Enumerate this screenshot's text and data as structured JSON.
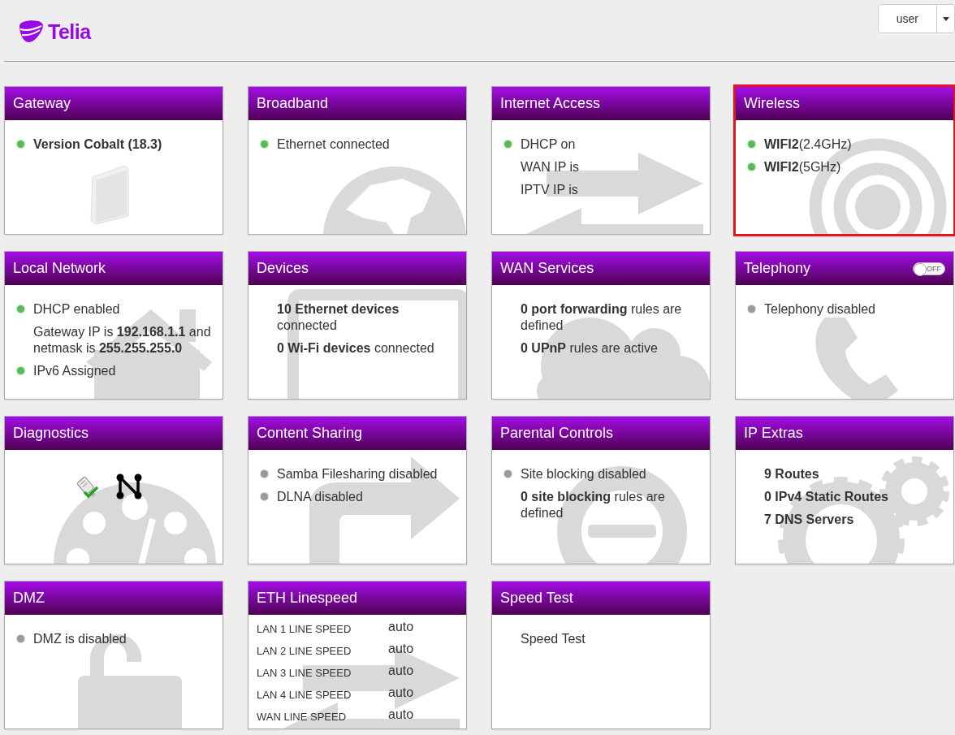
{
  "header": {
    "logo_text": "Telia",
    "user_button": "user"
  },
  "cards": [
    {
      "title": "Gateway",
      "kind": "lines",
      "highlighted": false,
      "lines": [
        {
          "kind": "status",
          "on": true,
          "text": "Version Cobalt (18.3)",
          "bold": true
        }
      ]
    },
    {
      "title": "Broadband",
      "kind": "lines",
      "highlighted": false,
      "lines": [
        {
          "kind": "status",
          "on": true,
          "text": "Ethernet connected"
        }
      ]
    },
    {
      "title": "Internet Access",
      "kind": "lines",
      "highlighted": false,
      "lines": [
        {
          "kind": "status",
          "on": true,
          "text": "DHCP on"
        },
        {
          "text": "WAN IP is"
        },
        {
          "text": "IPTV IP is"
        }
      ]
    },
    {
      "title": "Wireless",
      "kind": "lines",
      "highlighted": true,
      "lines": [
        {
          "kind": "status",
          "on": true,
          "text": "**WIFI2**(2.4GHz)"
        },
        {
          "kind": "status",
          "on": true,
          "text": "**WIFI2**(5GHz)"
        }
      ]
    },
    {
      "title": "Local Network",
      "kind": "lines",
      "highlighted": false,
      "lines": [
        {
          "kind": "status",
          "on": true,
          "text": "DHCP enabled"
        },
        {
          "text": "Gateway IP is **192.168.1.1** and netmask is **255.255.255.0**"
        },
        {
          "kind": "status",
          "on": true,
          "text": "IPv6 Assigned"
        }
      ]
    },
    {
      "title": "Devices",
      "kind": "lines",
      "highlighted": false,
      "lines": [
        {
          "text": "**10 Ethernet devices** connected"
        },
        {
          "text": "**0 Wi-Fi devices** connected"
        }
      ]
    },
    {
      "title": "WAN Services",
      "kind": "lines",
      "highlighted": false,
      "lines": [
        {
          "text": "**0 port forwarding** rules are defined"
        },
        {
          "text": "**0 UPnP** rules are active"
        }
      ]
    },
    {
      "title": "Telephony",
      "kind": "lines",
      "highlighted": false,
      "toggle": {
        "on": false,
        "label": "OFF"
      },
      "lines": [
        {
          "kind": "status",
          "on": false,
          "text": "Telephony disabled"
        }
      ]
    },
    {
      "title": "Diagnostics",
      "kind": "tools",
      "highlighted": false
    },
    {
      "title": "Content Sharing",
      "kind": "lines",
      "highlighted": false,
      "lines": [
        {
          "kind": "status",
          "on": false,
          "text": "Samba Filesharing disabled"
        },
        {
          "kind": "status",
          "on": false,
          "text": "DLNA disabled"
        }
      ]
    },
    {
      "title": "Parental Controls",
      "kind": "lines",
      "highlighted": false,
      "lines": [
        {
          "kind": "status",
          "on": false,
          "text": "Site blocking disabled"
        },
        {
          "text": "**0 site blocking** rules are defined"
        }
      ]
    },
    {
      "title": "IP Extras",
      "kind": "lines",
      "highlighted": false,
      "lines": [
        {
          "text": "9 Routes",
          "bold": true
        },
        {
          "text": "0 IPv4 Static Routes",
          "bold": true
        },
        {
          "text": "7 DNS Servers",
          "bold": true
        }
      ]
    },
    {
      "title": "DMZ",
      "kind": "lines",
      "highlighted": false,
      "lines": [
        {
          "kind": "status",
          "on": false,
          "text": "DMZ is disabled"
        }
      ]
    },
    {
      "title": "ETH Linespeed",
      "kind": "table",
      "highlighted": false,
      "rows": [
        {
          "label": "LAN 1 LINE SPEED",
          "value": "auto"
        },
        {
          "label": "LAN 2 LINE SPEED",
          "value": "auto"
        },
        {
          "label": "LAN 3 LINE SPEED",
          "value": "auto"
        },
        {
          "label": "LAN 4 LINE SPEED",
          "value": "auto"
        },
        {
          "label": "WAN LINE SPEED",
          "value": "auto"
        }
      ]
    },
    {
      "title": "Speed Test",
      "kind": "lines",
      "highlighted": false,
      "lines": [
        {
          "text": "Speed Test"
        }
      ]
    }
  ]
}
